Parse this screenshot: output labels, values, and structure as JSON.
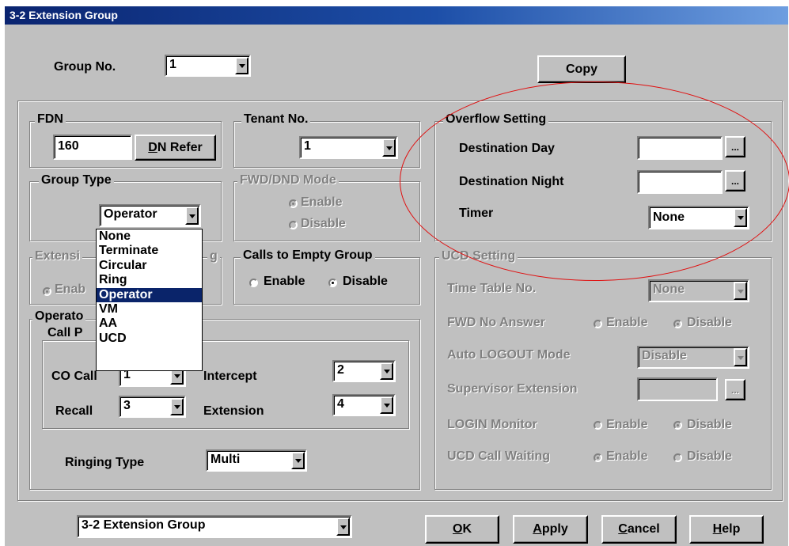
{
  "window": {
    "title": "3-2 Extension Group"
  },
  "top": {
    "group_no_label": "Group No.",
    "group_no_value": "1",
    "copy_label": "Copy"
  },
  "fdn": {
    "legend": "FDN",
    "value": "160",
    "dn_refer_label": "DN Refer",
    "dn_refer_underline": "D",
    "dn_refer_rest": "N Refer"
  },
  "tenant": {
    "legend": "Tenant No.",
    "value": "1"
  },
  "group_type": {
    "legend": "Group Type",
    "value": "Operator",
    "options": [
      "None",
      "Terminate",
      "Circular",
      "Ring",
      "Operator",
      "VM",
      "AA",
      "UCD"
    ],
    "selected_index": 4
  },
  "fwd_dnd": {
    "legend": "FWD/DND Mode",
    "enable": "Enable",
    "disable": "Disable",
    "selected": "Enable"
  },
  "extension_group": {
    "legend_left": "Extensi",
    "legend_right": "g",
    "enable_partial": "Enab"
  },
  "calls_empty": {
    "legend": "Calls to Empty Group",
    "enable": "Enable",
    "disable": "Disable",
    "selected": "Disable"
  },
  "operator": {
    "legend_partial": "Operato",
    "call_pri_partial": "Call P",
    "co_call_label": "CO Call",
    "co_call_value": "1",
    "intercept_label": "Intercept",
    "intercept_value": "2",
    "recall_label": "Recall",
    "recall_value": "3",
    "extension_label": "Extension",
    "extension_value": "4",
    "ringing_type_label": "Ringing Type",
    "ringing_type_value": "Multi"
  },
  "overflow": {
    "legend": "Overflow Setting",
    "dest_day_label": "Destination Day",
    "dest_day_value": "",
    "dest_night_label": "Destination Night",
    "dest_night_value": "",
    "timer_label": "Timer",
    "timer_value": "None",
    "ellipsis": "..."
  },
  "ucd": {
    "legend": "UCD Setting",
    "time_table_label": "Time Table No.",
    "time_table_value": "None",
    "fwd_no_answer_label": "FWD No Answer",
    "fwd_no_answer_selected": "Disable",
    "auto_logout_label": "Auto LOGOUT Mode",
    "auto_logout_value": "Disable",
    "supervisor_label": "Supervisor Extension",
    "supervisor_value": "",
    "login_monitor_label": "LOGIN Monitor",
    "login_monitor_selected": "Disable",
    "ucd_call_waiting_label": "UCD Call Waiting",
    "ucd_call_waiting_selected": "Enable",
    "enable": "Enable",
    "disable": "Disable"
  },
  "bottom": {
    "page_select_value": "3-2 Extension Group",
    "ok_u": "O",
    "ok_rest": "K",
    "apply_u": "A",
    "apply_rest": "pply",
    "cancel_u": "C",
    "cancel_rest": "ancel",
    "help_u": "H",
    "help_rest": "elp"
  },
  "annotation_color": "#e01010"
}
